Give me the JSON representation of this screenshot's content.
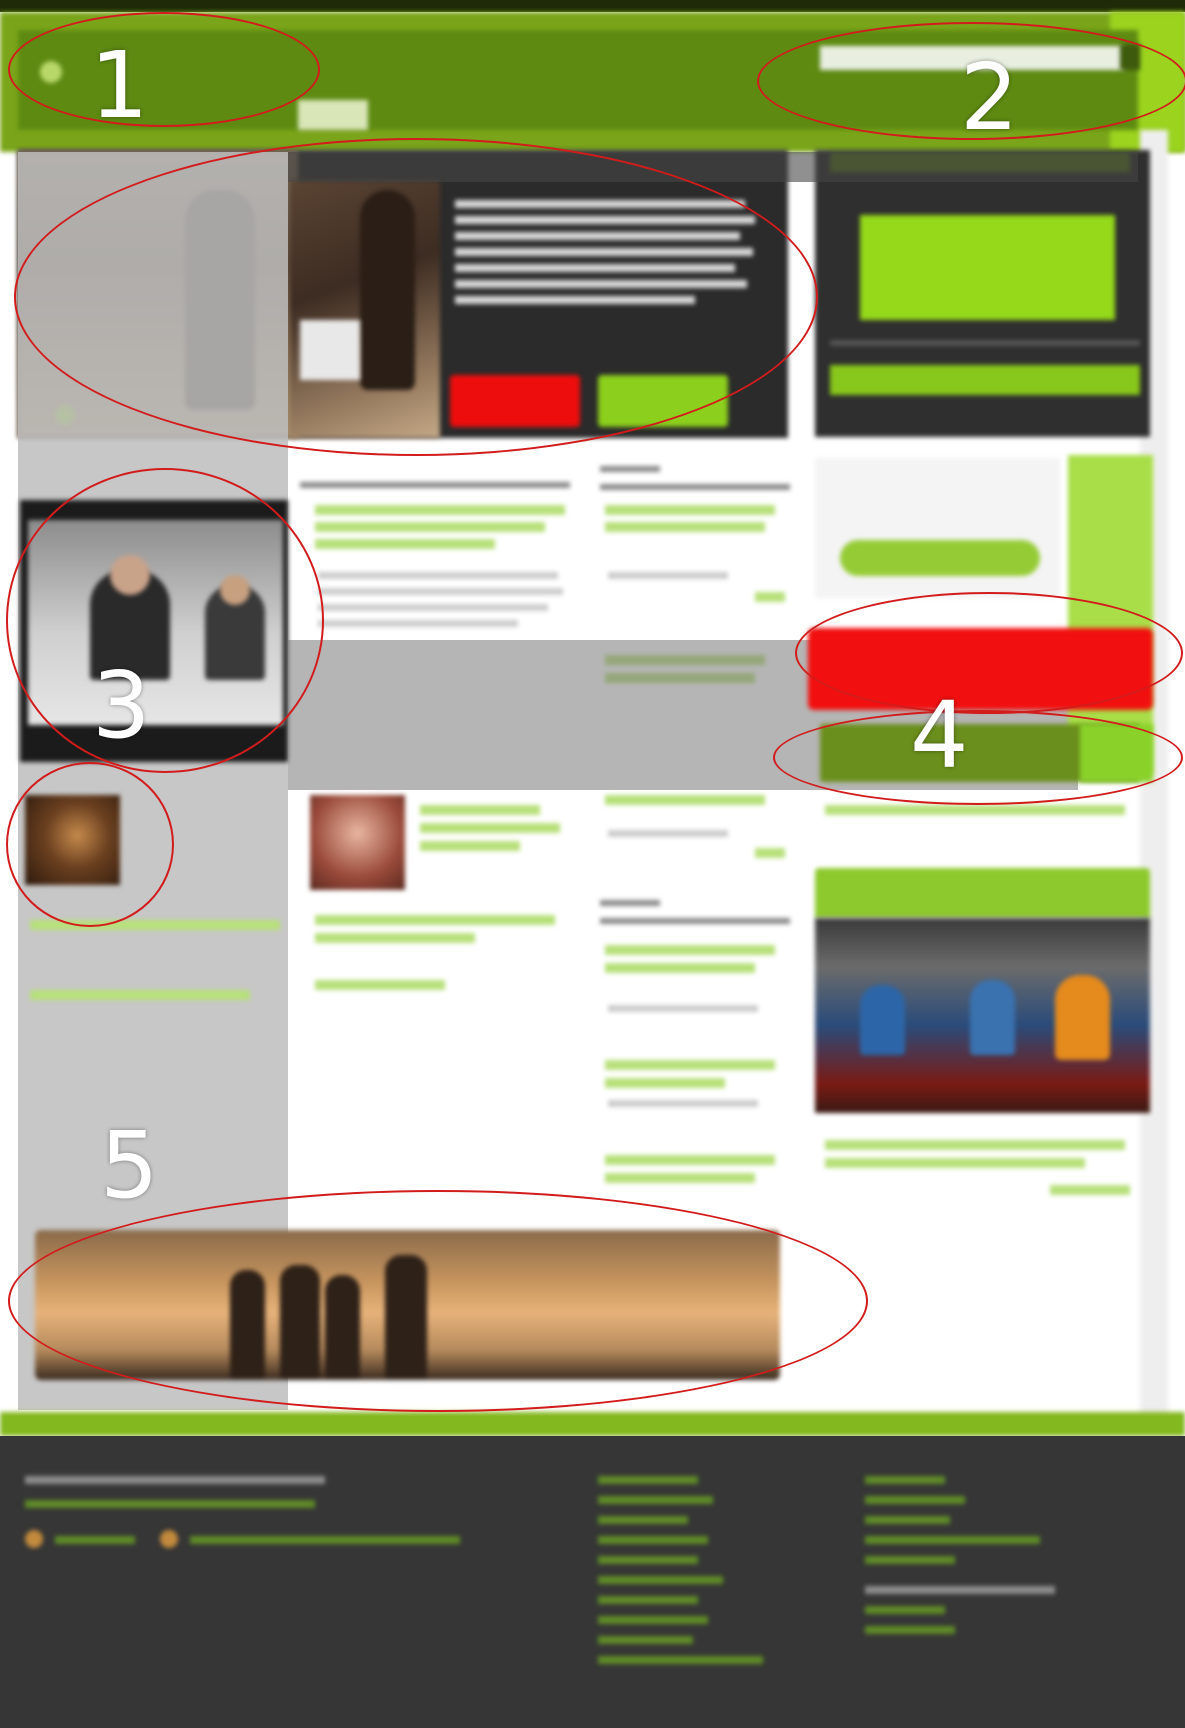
{
  "header": {
    "logo_text": "",
    "search_placeholder": ""
  },
  "annotations": [
    {
      "label": "1",
      "target": "logo"
    },
    {
      "label": "2",
      "target": "search"
    },
    {
      "label": "3",
      "target": "video"
    },
    {
      "label": "4",
      "target": "donate-subscribe"
    },
    {
      "label": "5",
      "target": "banner"
    }
  ],
  "colors": {
    "brand_green": "#7aa51a",
    "accent_red": "#f20f0f",
    "accent_green": "#8ccf1c",
    "footer_dark": "#363636",
    "annotation_red": "#d21c1c"
  },
  "icons": [
    "logo-mark-icon",
    "search-icon",
    "play-icon",
    "rss-icon"
  ]
}
